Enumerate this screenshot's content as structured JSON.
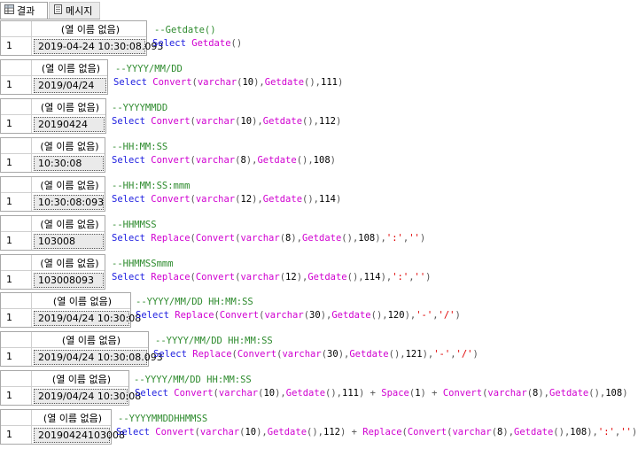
{
  "tabs": [
    {
      "label": "결과",
      "icon": "grid-icon",
      "active": true
    },
    {
      "label": "메시지",
      "icon": "message-icon",
      "active": false
    }
  ],
  "column_header": "(열 이름 없음)",
  "blocks": [
    {
      "row": "1",
      "value": "2019-04-24 10:30:08.093",
      "comment": "--Getdate()",
      "sql": "Select Getdate()"
    },
    {
      "row": "1",
      "value": "2019/04/24",
      "comment": "--YYYY/MM/DD",
      "sql": "Select Convert(varchar(10),Getdate(),111)"
    },
    {
      "row": "1",
      "value": "20190424",
      "comment": "--YYYYMMDD",
      "sql": "Select Convert(varchar(10),Getdate(),112)"
    },
    {
      "row": "1",
      "value": "10:30:08",
      "comment": "--HH:MM:SS",
      "sql": "Select Convert(varchar(8),Getdate(),108)"
    },
    {
      "row": "1",
      "value": "10:30:08:093",
      "comment": "--HH:MM:SS:mmm",
      "sql": "Select Convert(varchar(12),Getdate(),114)"
    },
    {
      "row": "1",
      "value": "103008",
      "comment": "--HHMMSS",
      "sql": "Select Replace(Convert(varchar(8),Getdate(),108),':','')"
    },
    {
      "row": "1",
      "value": "103008093",
      "comment": "--HHMMSSmmm",
      "sql": "Select Replace(Convert(varchar(12),Getdate(),114),':','')"
    },
    {
      "row": "1",
      "value": "2019/04/24 10:30:08",
      "comment": "--YYYY/MM/DD HH:MM:SS",
      "sql": "Select Replace(Convert(varchar(30),Getdate(),120),'-','/')"
    },
    {
      "row": "1",
      "value": "2019/04/24 10:30:08.093",
      "comment": "--YYYY/MM/DD HH:MM:SS",
      "sql": "Select Replace(Convert(varchar(30),Getdate(),121),'-','/')"
    },
    {
      "row": "1",
      "value": "2019/04/24 10:30:08",
      "comment": "--YYYY/MM/DD HH:MM:SS",
      "sql": "Select Convert(varchar(10),Getdate(),111) + Space(1) + Convert(varchar(8),Getdate(),108)"
    },
    {
      "row": "1",
      "value": "20190424103008",
      "comment": "--YYYYMMDDHHMMSS",
      "sql": "Select Convert(varchar(10),Getdate(),112) + Replace(Convert(varchar(8),Getdate(),108),':','')"
    }
  ],
  "colors": {
    "keyword": "#2020e0",
    "function": "#d000d0",
    "string": "#e00000",
    "comment": "#2e8b2e"
  }
}
